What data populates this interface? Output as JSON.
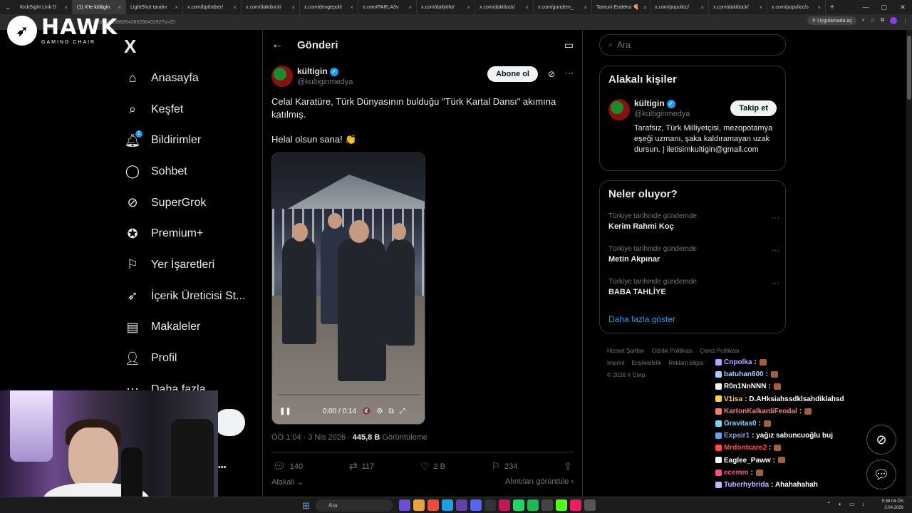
{
  "browser": {
    "tabs": [
      {
        "label": "KickSight Link D"
      },
      {
        "label": "(1) X'te kültigin"
      },
      {
        "label": "LightShot tarafın"
      },
      {
        "label": "x.com/bpthaber/"
      },
      {
        "label": "x.com/daktilock/"
      },
      {
        "label": "x.com/dengepolit"
      },
      {
        "label": "x.com/PARLA3v"
      },
      {
        "label": "x.com/dailytrkt/"
      },
      {
        "label": "x.com/daktilock/"
      },
      {
        "label": "x.com/gundem_"
      },
      {
        "label": "Tantuni Endeksi 🍕"
      },
      {
        "label": "x.com/populicc/"
      },
      {
        "label": "x.com/daktilock/"
      },
      {
        "label": "x.com/populicc/s"
      }
    ],
    "url": "/status/2039826438329643292?s=20",
    "app_button": "Uygulamada aç"
  },
  "overlay": {
    "brand_big": "HAWK",
    "brand_small": "GAMING CHAIR"
  },
  "nav": {
    "logo": "X",
    "items": [
      {
        "label": "Anasayfa",
        "icon": "home-icon"
      },
      {
        "label": "Keşfet",
        "icon": "search-icon"
      },
      {
        "label": "Bildirimler",
        "icon": "bell-icon",
        "badge": "1"
      },
      {
        "label": "Sohbet",
        "icon": "chat-icon"
      },
      {
        "label": "SuperGrok",
        "icon": "grok-icon"
      },
      {
        "label": "Premium+",
        "icon": "premium-icon"
      },
      {
        "label": "Yer İşaretleri",
        "icon": "bookmark-icon"
      },
      {
        "label": "İçerik Üreticisi St...",
        "icon": "rocket-icon"
      },
      {
        "label": "Makaleler",
        "icon": "article-icon"
      },
      {
        "label": "Profil",
        "icon": "person-icon"
      },
      {
        "label": "Daha fazla",
        "icon": "more-icon"
      }
    ]
  },
  "post": {
    "header_title": "Gönderi",
    "author_name": "kültigin",
    "author_handle": "@kultiginmedya",
    "subscribe_label": "Abone ol",
    "text": "Celal Karatüre, Türk Dünyasının bulduğu \"Türk Kartal Dansı\" akımına katılmış.",
    "text2": "Helal olsun sana! 👏",
    "video_time": "0:00 / 0:14",
    "time": "ÖÖ 1:04 · 3 Nis 2026 ·",
    "views_count": "445,8 B",
    "views_label": "Görüntüleme",
    "replies": "140",
    "reposts": "117",
    "likes": "2 B",
    "bookmarks": "234",
    "related_label": "Alakalı",
    "quotes_label": "Alıntıları görüntüle"
  },
  "right": {
    "search_placeholder": "Ara",
    "related_title": "Alakalı kişiler",
    "related_name": "kültigin",
    "related_handle": "@kultiginmedya",
    "follow_label": "Takip et",
    "related_bio": "Tarafsız, Türk Milliyetçisi, mezopotamya eşeği uzmanı, şaka kaldıramayan uzak dursun. | iletisimkultigin@gmail.com",
    "trends_title": "Neler oluyor?",
    "trends": [
      {
        "context": "Türkiye tarihinde gündemde",
        "name": "Kerim Rahmi Koç"
      },
      {
        "context": "Türkiye tarihinde gündemde",
        "name": "Metin Akpınar"
      },
      {
        "context": "Türkiye tarihinde gündemde",
        "name": "BABA TAHLİYE"
      }
    ],
    "show_more": "Daha fazla göster",
    "footer": [
      "Hizmet Şartları",
      "Gizlilik Politikası",
      "Çerez Politikası",
      "Imprint",
      "Erişilebilirlik",
      "Reklam bilgisi",
      "© 2026 X Corp."
    ]
  },
  "chat": [
    {
      "user": "Cnpolka",
      "color": "#b9a3ff",
      "msg": ":"
    },
    {
      "user": "batuhan600",
      "color": "#9fd0ff",
      "msg": ":"
    },
    {
      "user": "R0n1NnNNN",
      "color": "#ffffff",
      "msg": ":"
    },
    {
      "user": "V1isa",
      "color": "#ffd23f",
      "msg": ": D.AHksiahssdklsahdiklahsd"
    },
    {
      "user": "KartonKalkanliFeodal",
      "color": "#ff7a7a",
      "msg": ":"
    },
    {
      "user": "Gravitas0",
      "color": "#7dd3fc",
      "msg": ":"
    },
    {
      "user": "Expair1",
      "color": "#60a5fa",
      "msg": ": yağız sabuncuoğlu buj"
    },
    {
      "user": "Mrdontcare2",
      "color": "#ff4d4d",
      "msg": ":"
    },
    {
      "user": "Eaglee_Paww",
      "color": "#ffffff",
      "msg": ":"
    },
    {
      "user": "ecemm",
      "color": "#ff4d8d",
      "msg": ":"
    },
    {
      "user": "Tuberhybrida",
      "color": "#c4b5fd",
      "msg": ": Ahahahahah"
    }
  ],
  "taskbar": {
    "search": "Ara",
    "time": "5:36:04 ÖS",
    "date": "3.04.2026"
  }
}
